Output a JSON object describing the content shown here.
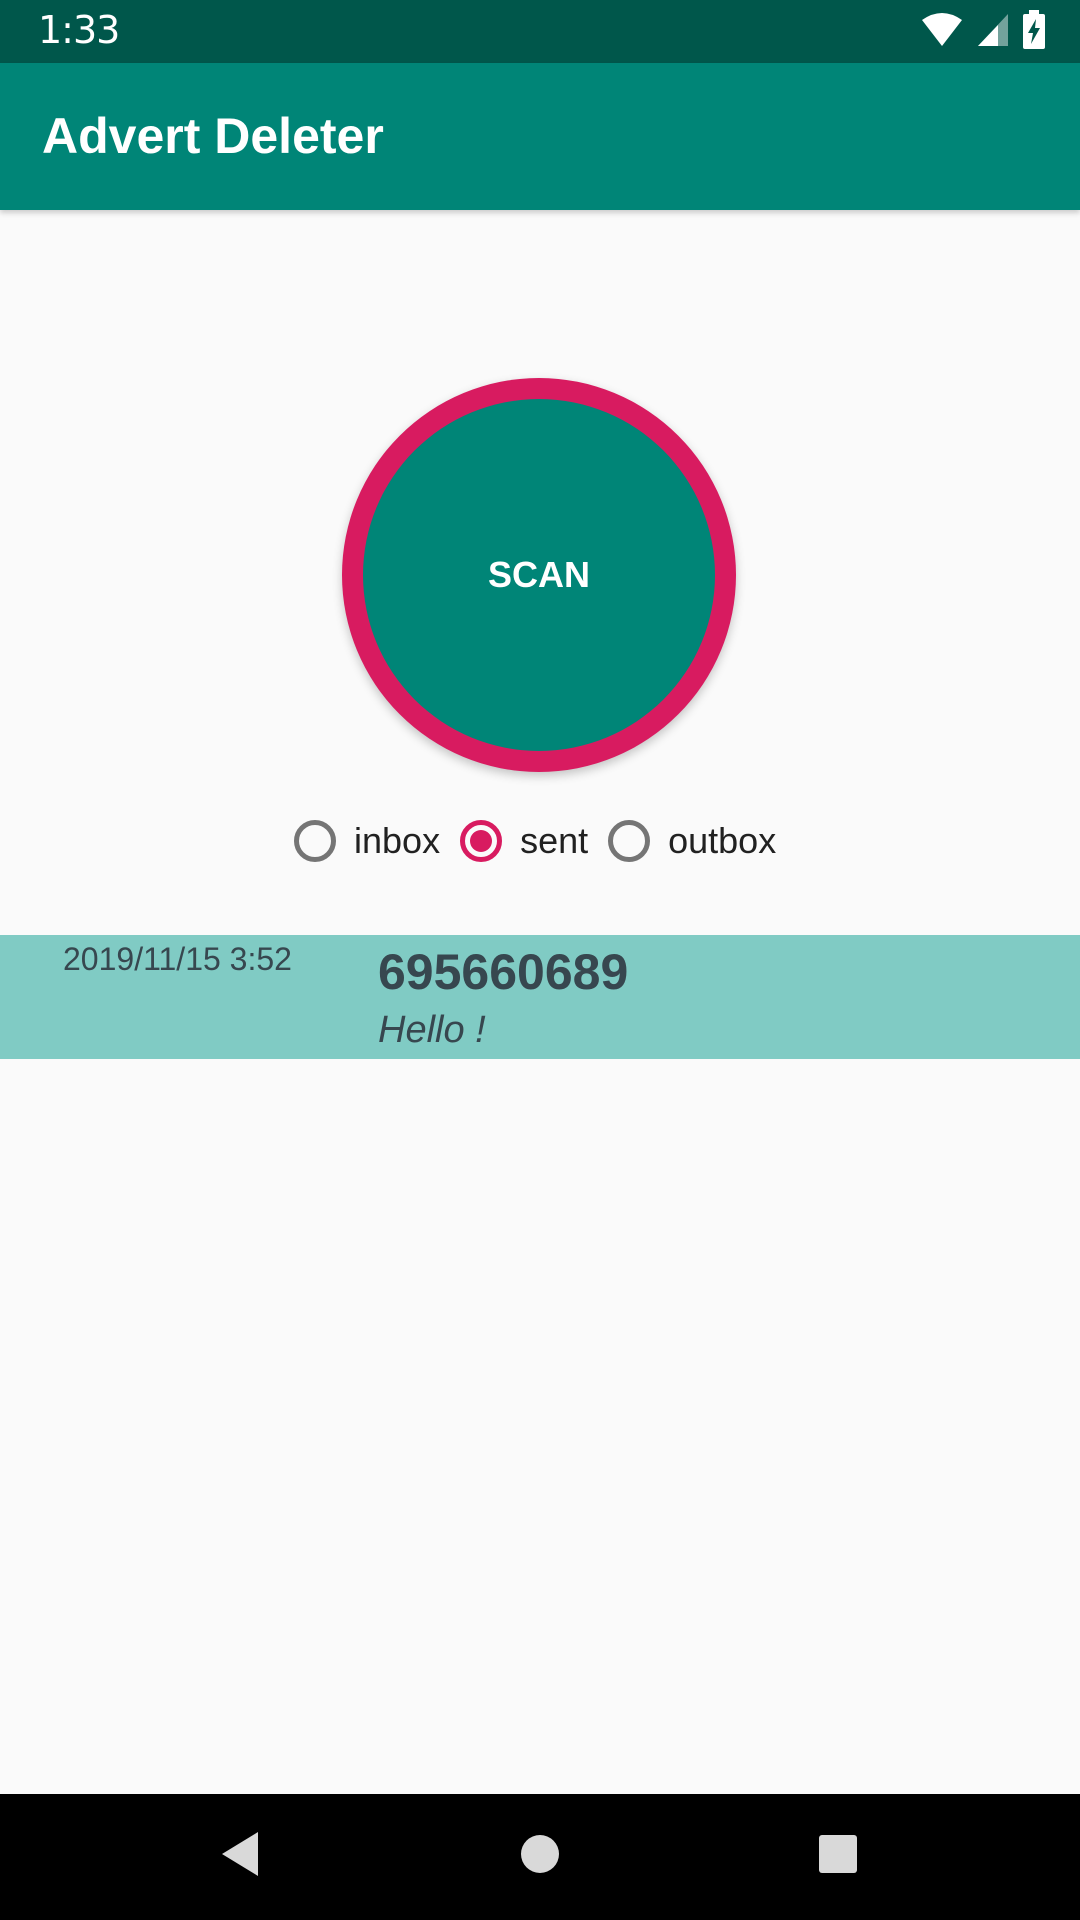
{
  "status_bar": {
    "time": "1:33",
    "icons": [
      "wifi-icon",
      "signal-icon",
      "battery-charging-icon"
    ]
  },
  "app_bar": {
    "title": "Advert Deleter",
    "color": "#008577"
  },
  "scan": {
    "label": "SCAN",
    "fill_color": "#008577",
    "ring_color": "#d81b60"
  },
  "radio_group": {
    "options": [
      {
        "label": "inbox",
        "checked": false
      },
      {
        "label": "sent",
        "checked": true
      },
      {
        "label": "outbox",
        "checked": false
      }
    ]
  },
  "messages": [
    {
      "date": "2019/11/15 3:52",
      "sender": "695660689",
      "body": "Hello !"
    }
  ],
  "nav_bar": {
    "icons": [
      "back-icon",
      "home-icon",
      "recents-icon"
    ]
  }
}
